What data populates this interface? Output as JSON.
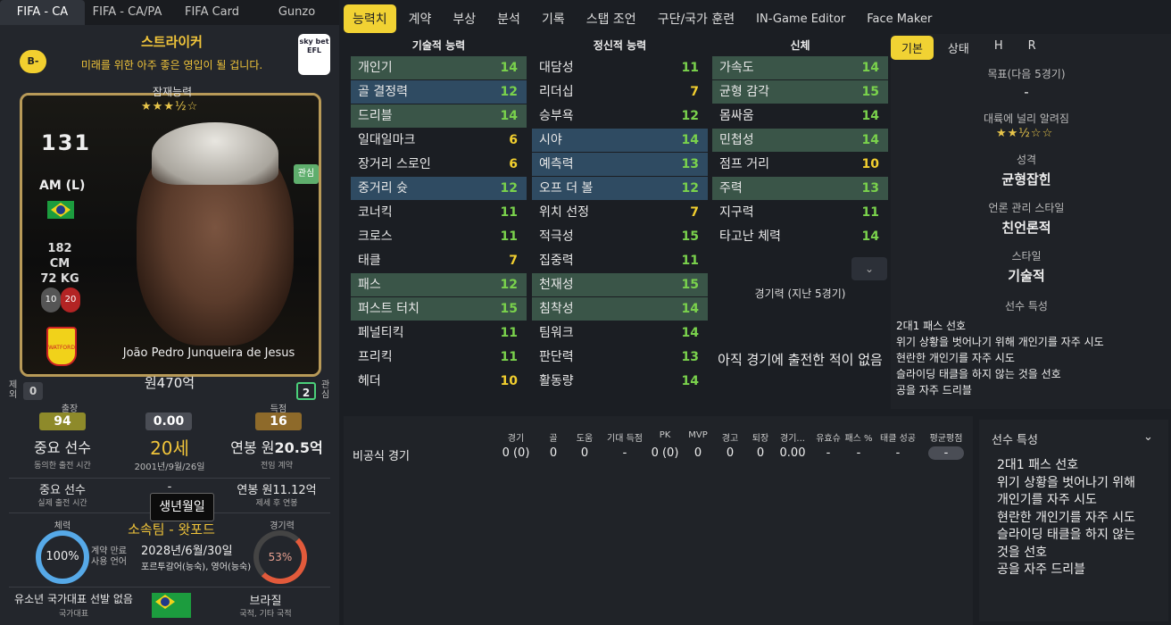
{
  "left_tabs": [
    "FIFA - CA",
    "FIFA - CA/PA",
    "FIFA Card",
    "Gunzo"
  ],
  "grade": "B-",
  "role": "스트라이커",
  "role_desc": "미래를 위한 아주 좋은 영입이 될 겁니다.",
  "league_badge": "sky bet EFL",
  "potential_label": "잠재능력",
  "potential_stars": "★★★½☆",
  "current_ability": "131",
  "position": "AM (L)",
  "height": "182 CM",
  "weight": "72 KG",
  "numbers": [
    "10",
    "20"
  ],
  "interest_label": "관심",
  "club_badge": "WATFORD",
  "player_name": "João Pedro Junqueira de Jesus",
  "value": "원470억",
  "exclude_label": "제외",
  "exclude_count": "0",
  "interest_side_label": "관심",
  "interest_count": "2",
  "apps_label": "출장",
  "apps": "94",
  "rating_center": "0.00",
  "goals_label": "득점",
  "goals": "16",
  "squad_role": "중요 선수",
  "squad_role_sub": "동의한 출전 시간",
  "age": "20세",
  "birthdate": "2001년/9월/26일",
  "wage_prefix": "연봉 원",
  "wage": "20.5억",
  "wage_sub": "전임 계약",
  "actual_role": "중요 선수",
  "actual_role_sub": "실제 출전 시간",
  "dash": "-",
  "tooltip": "생년월일",
  "wage2": "연봉 원11.12억",
  "wage2_sub": "제세 후 연봉",
  "condition_label": "체력",
  "condition": "100%",
  "club_line": "소속팀 - 왓포드",
  "contract_label": "계약 만료",
  "contract_date": "2028년/6월/30일",
  "lang_label": "사용 언어",
  "languages": "포르투갈어(능숙), 영어(능숙)",
  "sharpness_label": "경기력",
  "sharpness": "53%",
  "youth_intl": "유소년 국가대표 선발 없음",
  "youth_intl_sub": "국가대표",
  "nation": "브라질",
  "nation_sub": "국적, 기타 국적",
  "main_tabs": [
    "능력치",
    "계약",
    "부상",
    "분석",
    "기록",
    "스탭 조언",
    "구단/국가 훈련",
    "IN-Game Editor",
    "Face Maker"
  ],
  "col_technical": "기술적 능력",
  "col_mental": "정신적 능력",
  "col_physical": "신체",
  "technical": [
    {
      "n": "개인기",
      "v": "14"
    },
    {
      "n": "골 결정력",
      "v": "12"
    },
    {
      "n": "드리블",
      "v": "14"
    },
    {
      "n": "일대일마크",
      "v": "6"
    },
    {
      "n": "장거리 스로인",
      "v": "6"
    },
    {
      "n": "중거리 슛",
      "v": "12"
    },
    {
      "n": "코너킥",
      "v": "11"
    },
    {
      "n": "크로스",
      "v": "11"
    },
    {
      "n": "태클",
      "v": "7"
    },
    {
      "n": "패스",
      "v": "12"
    },
    {
      "n": "퍼스트 터치",
      "v": "15"
    },
    {
      "n": "페널티킥",
      "v": "11"
    },
    {
      "n": "프리킥",
      "v": "11"
    },
    {
      "n": "헤더",
      "v": "10"
    }
  ],
  "mental": [
    {
      "n": "대담성",
      "v": "11"
    },
    {
      "n": "리더십",
      "v": "7"
    },
    {
      "n": "승부욕",
      "v": "12"
    },
    {
      "n": "시야",
      "v": "14"
    },
    {
      "n": "예측력",
      "v": "13"
    },
    {
      "n": "오프 더 볼",
      "v": "12"
    },
    {
      "n": "위치 선정",
      "v": "7"
    },
    {
      "n": "적극성",
      "v": "15"
    },
    {
      "n": "집중력",
      "v": "11"
    },
    {
      "n": "천재성",
      "v": "15"
    },
    {
      "n": "침착성",
      "v": "14"
    },
    {
      "n": "팀워크",
      "v": "14"
    },
    {
      "n": "판단력",
      "v": "13"
    },
    {
      "n": "활동량",
      "v": "14"
    }
  ],
  "physical": [
    {
      "n": "가속도",
      "v": "14"
    },
    {
      "n": "균형 감각",
      "v": "15"
    },
    {
      "n": "몸싸움",
      "v": "14"
    },
    {
      "n": "민첩성",
      "v": "14"
    },
    {
      "n": "점프 거리",
      "v": "10"
    },
    {
      "n": "주력",
      "v": "13"
    },
    {
      "n": "지구력",
      "v": "11"
    },
    {
      "n": "타고난 체력",
      "v": "14"
    }
  ],
  "form_label": "경기력 (지난 5경기)",
  "no_apps": "아직 경기에 출전한 적이 없음",
  "right_tabs": [
    "기본",
    "상태",
    "H",
    "R"
  ],
  "target_label": "목표(다음 5경기)",
  "target_value": "-",
  "reputation_label": "대륙에 널리 알려짐",
  "reputation_stars": "★★½☆☆",
  "personality_label": "성격",
  "personality": "균형잡힌",
  "media_label": "언론 관리 스타일",
  "media": "친언론적",
  "style_label": "스타일",
  "style": "기술적",
  "traits_label": "선수 특성",
  "traits": [
    "2대1 패스 선호",
    "위기 상황을 벗어나기 위해 개인기를 자주 시도",
    "현란한 개인기를 자주 시도",
    "슬라이딩 태클을 하지 않는 것을 선호",
    "공을 자주 드리블"
  ],
  "stats_headers": [
    "경기",
    "골",
    "도움",
    "기대 득점",
    "PK",
    "MVP",
    "경고",
    "퇴장",
    "경기...",
    "유효슈",
    "패스 %",
    "태클 성공",
    "평균평점"
  ],
  "stats_row_label": "비공식 경기",
  "stats_row": [
    "0 (0)",
    "0",
    "0",
    "-",
    "0 (0)",
    "0",
    "0",
    "0",
    "0.00",
    "-",
    "-",
    "-",
    "-"
  ],
  "traits2_label": "선수 특성",
  "traits2": [
    "2대1 패스 선호",
    "위기 상황을 벗어나기 위해",
    "개인기를 자주 시도",
    "현란한 개인기를 자주 시도",
    "슬라이딩 태클을 하지 않는",
    "것을 선호",
    "공을 자주 드리블"
  ],
  "colors": {
    "accent": "#f1d233",
    "green": "#7ad24c",
    "yellow": "#f2cf2f"
  }
}
